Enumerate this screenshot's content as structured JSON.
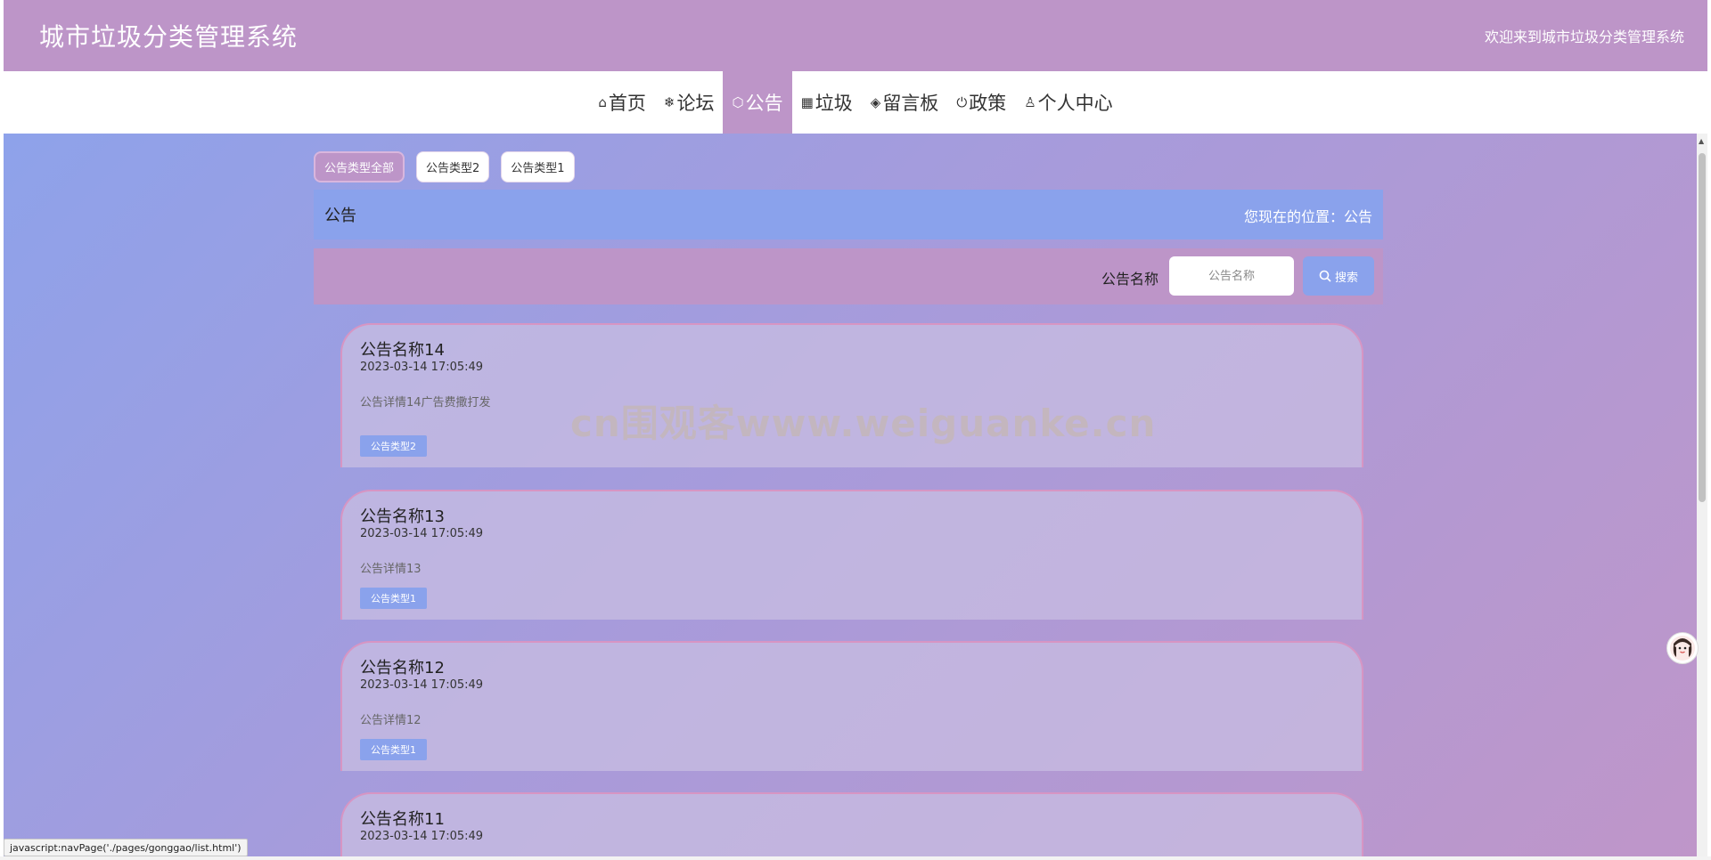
{
  "header": {
    "title": "城市垃圾分类管理系统",
    "welcome": "欢迎来到城市垃圾分类管理系统"
  },
  "nav": {
    "items": [
      {
        "label": "首页",
        "icon": "home-icon"
      },
      {
        "label": "论坛",
        "icon": "snowflake-icon"
      },
      {
        "label": "公告",
        "icon": "cube-icon",
        "active": true
      },
      {
        "label": "垃圾",
        "icon": "grid-icon"
      },
      {
        "label": "留言板",
        "icon": "layers-icon"
      },
      {
        "label": "政策",
        "icon": "power-icon"
      },
      {
        "label": "个人中心",
        "icon": "user-icon"
      }
    ]
  },
  "filters": {
    "items": [
      {
        "label": "公告类型全部",
        "active": true
      },
      {
        "label": "公告类型2"
      },
      {
        "label": "公告类型1"
      }
    ]
  },
  "breadcrumb": {
    "title": "公告",
    "location": "您现在的位置：公告"
  },
  "search": {
    "label": "公告名称",
    "placeholder": "公告名称",
    "button": "搜索"
  },
  "cards": [
    {
      "title": "公告名称14",
      "time": "2023-03-14 17:05:49",
      "desc": "公告详情14广告费撒打发",
      "tag": "公告类型2"
    },
    {
      "title": "公告名称13",
      "time": "2023-03-14 17:05:49",
      "desc": "公告详情13",
      "tag": "公告类型1"
    },
    {
      "title": "公告名称12",
      "time": "2023-03-14 17:05:49",
      "desc": "公告详情12",
      "tag": "公告类型1"
    },
    {
      "title": "公告名称11",
      "time": "2023-03-14 17:05:49"
    }
  ],
  "watermark": "cn围观客www.weiguanke.cn",
  "status_bar": "javascript:navPage('./pages/gonggao/list.html')",
  "colors": {
    "header": "#bd95c8",
    "accent_blue": "#8aa2ec",
    "card_border": "#d795c3"
  }
}
